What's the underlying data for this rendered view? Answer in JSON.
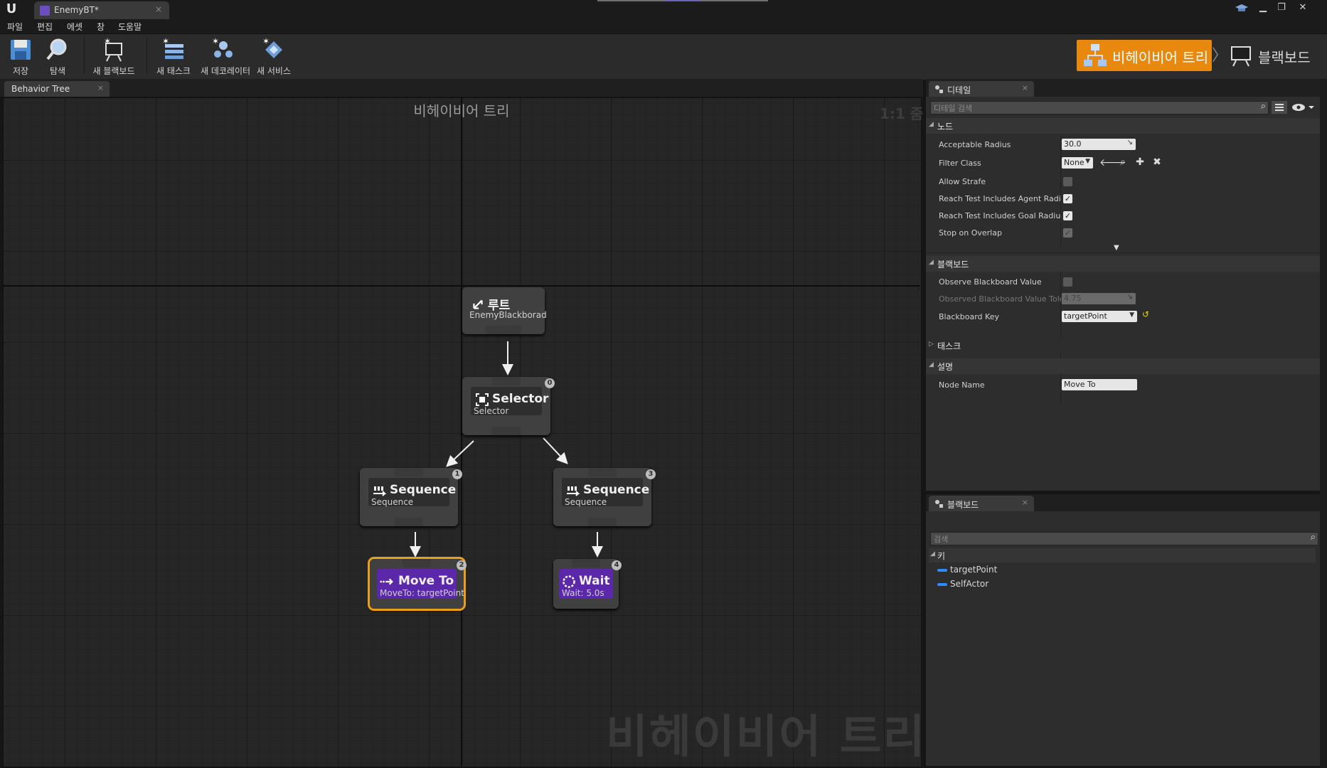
{
  "window": {
    "tab_title": "EnemyBT*",
    "tab_close": "×",
    "min": "▁",
    "max": "❐",
    "close": "✕"
  },
  "menu": [
    "파일",
    "편집",
    "에셋",
    "창",
    "도움말"
  ],
  "toolbar": {
    "save": "저장",
    "browse": "탐색",
    "new_blackboard": "새 블랙보드",
    "new_task": "새 태스크",
    "new_decorator": "새 데코레이터",
    "new_service": "새 서비스"
  },
  "modes": {
    "behavior_tree": "비헤이비어 트리",
    "chevron": "〉",
    "blackboard": "블랙보드"
  },
  "graph": {
    "tab": "Behavior Tree",
    "tab_close": "×",
    "title": "비헤이비어 트리",
    "zoom": "1:1 줌",
    "watermark": "비헤이비어 트리",
    "nodes": {
      "root": {
        "title": "루트",
        "sub": "EnemyBlackborad"
      },
      "selector": {
        "title": "Selector",
        "sub": "Selector",
        "index": "0"
      },
      "seq1": {
        "title": "Sequence",
        "sub": "Sequence",
        "index": "1"
      },
      "seq2": {
        "title": "Sequence",
        "sub": "Sequence",
        "index": "3"
      },
      "moveto": {
        "title": "Move To",
        "sub": "MoveTo: targetPoint",
        "index": "2"
      },
      "wait": {
        "title": "Wait",
        "sub": "Wait: 5.0s",
        "index": "4"
      }
    }
  },
  "details": {
    "tab": "디테일",
    "tab_close": "×",
    "search_placeholder": "디테일 검색",
    "cat_node": "노드",
    "acceptable_radius_label": "Acceptable Radius",
    "acceptable_radius_value": "30.0",
    "filter_class_label": "Filter Class",
    "filter_class_value": "None",
    "allow_strafe_label": "Allow Strafe",
    "reach_agent_label": "Reach Test Includes Agent Radius",
    "reach_goal_label": "Reach Test Includes Goal Radius",
    "stop_overlap_label": "Stop on Overlap",
    "cat_blackboard": "블랙보드",
    "observe_bb_label": "Observe Blackboard Value",
    "observed_tol_label": "Observed Blackboard Value Tolerance",
    "observed_tol_value": "4.75",
    "bb_key_label": "Blackboard Key",
    "bb_key_value": "targetPoint",
    "cat_task": "태스크",
    "cat_desc": "설명",
    "node_name_label": "Node Name",
    "node_name_value": "Move To",
    "check": "✓"
  },
  "blackboard": {
    "tab": "블랙보드",
    "tab_close": "×",
    "search_placeholder": "검색",
    "cat_keys": "키",
    "keys": [
      "targetPoint",
      "SelfActor"
    ]
  },
  "colors": {
    "accent_orange": "#e8880f",
    "task_purple": "#5a28a8",
    "key_blue": "#2a8cff",
    "selection": "#e9a018"
  }
}
